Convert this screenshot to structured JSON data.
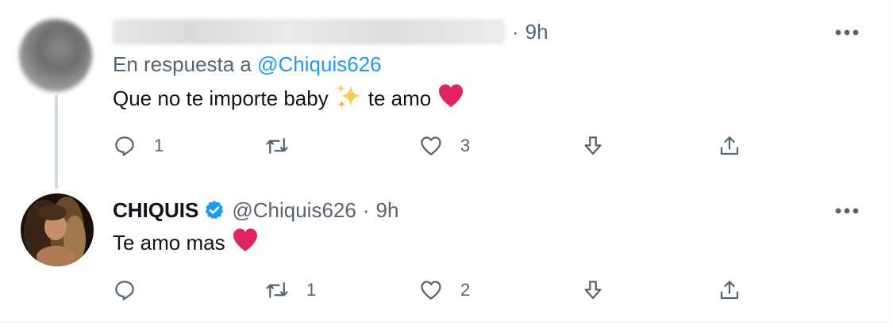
{
  "tweets": [
    {
      "author_name": "",
      "time": "9h",
      "reply_to_prefix": "En respuesta a",
      "reply_to_handle": "@Chiquis626",
      "text_before_emoji": "Que no te importe baby",
      "text_after_emoji": "te amo",
      "reply_count": "1",
      "retweet_count": "",
      "like_count": "3"
    },
    {
      "author_name": "CHIQUIS",
      "handle": "@Chiquis626",
      "separator": "·",
      "time": "9h",
      "text": "Te amo mas",
      "reply_count": "",
      "retweet_count": "1",
      "like_count": "2"
    }
  ],
  "separator": "·",
  "icons": {
    "reply": "reply-icon",
    "retweet": "retweet-icon",
    "like": "heart-outline-icon",
    "downvote": "down-arrow-icon",
    "share": "share-icon",
    "more": "more-dots-icon",
    "verified": "verified-badge-icon",
    "sparkles": "sparkles-emoji",
    "red_heart": "red-heart-emoji"
  },
  "colors": {
    "text_primary": "#0f1419",
    "text_muted": "#536471",
    "link": "#1d9bf0",
    "verified": "#1d9bf0",
    "heart_emoji": "#e0245e",
    "sparkles": "#ffcc4d",
    "thread_line": "#cfd9de"
  }
}
